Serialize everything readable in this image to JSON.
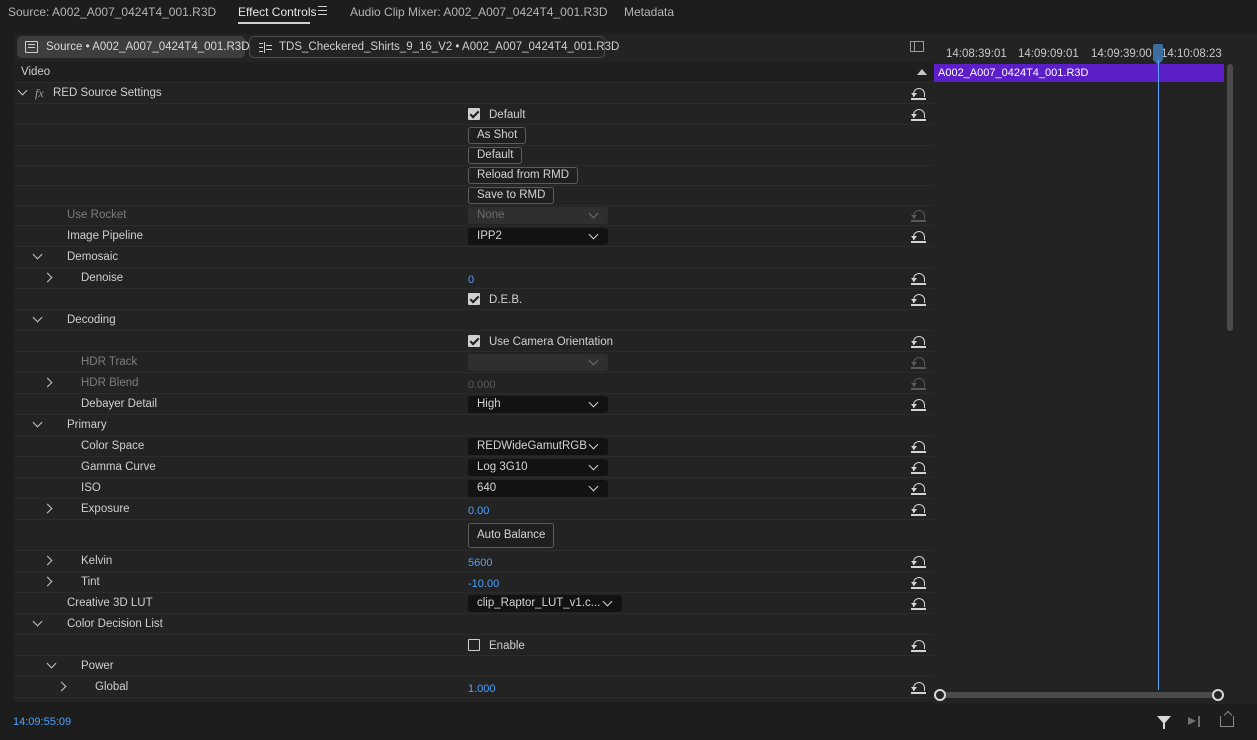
{
  "tabs": [
    {
      "label": "Source: A002_A007_0424T4_001.R3D",
      "active": false
    },
    {
      "label": "Effect Controls",
      "active": true
    },
    {
      "label": "Audio Clip Mixer: A002_A007_0424T4_001.R3D",
      "active": false
    },
    {
      "label": "Metadata",
      "active": false
    }
  ],
  "source_bar": {
    "master_clip": "Source • A002_A007_0424T4_001.R3D",
    "sequence_clip": "TDS_Checkered_Shirts_9_16_V2 • A002_A007_0424T4_001.R3D"
  },
  "video_section": {
    "label": "Video"
  },
  "effect": {
    "name": "RED Source Settings"
  },
  "rows": {
    "default_checkbox": {
      "label": "Default",
      "checked": true
    },
    "as_shot": "As Shot",
    "default_btn": "Default",
    "reload_rmd": "Reload from RMD",
    "save_rmd": "Save to RMD",
    "use_rocket": {
      "label": "Use Rocket",
      "value": "None"
    },
    "image_pipeline": {
      "label": "Image Pipeline",
      "value": "IPP2"
    },
    "demosaic": "Demosaic",
    "denoise": {
      "label": "Denoise",
      "value": "0"
    },
    "deb": {
      "label": "D.E.B.",
      "checked": true
    },
    "decoding": "Decoding",
    "camera_orientation": {
      "label": "Use Camera Orientation",
      "checked": true
    },
    "hdr_track": {
      "label": "HDR Track",
      "value": ""
    },
    "hdr_blend": {
      "label": "HDR Blend",
      "value": "0.000"
    },
    "debayer_detail": {
      "label": "Debayer Detail",
      "value": "High"
    },
    "primary": "Primary",
    "color_space": {
      "label": "Color Space",
      "value": "REDWideGamutRGB"
    },
    "gamma_curve": {
      "label": "Gamma Curve",
      "value": "Log 3G10"
    },
    "iso": {
      "label": "ISO",
      "value": "640"
    },
    "exposure": {
      "label": "Exposure",
      "value": "0.00"
    },
    "auto_balance": "Auto Balance",
    "kelvin": {
      "label": "Kelvin",
      "value": "5600"
    },
    "tint": {
      "label": "Tint",
      "value": "-10.00"
    },
    "creative_lut": {
      "label": "Creative 3D LUT",
      "value": "clip_Raptor_LUT_v1.c..."
    },
    "cdl": "Color Decision List",
    "cdl_enable": {
      "label": "Enable",
      "checked": false
    },
    "power": "Power",
    "global": {
      "label": "Global",
      "value": "1.000"
    }
  },
  "timeline": {
    "timecodes": [
      "14:08:39:01",
      "14:09:09:01",
      "14:09:39:00",
      "14:10:08:23"
    ],
    "clip_name": "A002_A007_0424T4_001.R3D"
  },
  "footer": {
    "current_time": "14:09:55:09"
  },
  "icons": {
    "reset": "reset-parameter-icon",
    "filter": "filter-icon",
    "play": "play-audio-icon",
    "export": "export-icon"
  },
  "colors": {
    "accent_blue": "#4da1ff",
    "clip_purple": "#5b1ec9"
  }
}
